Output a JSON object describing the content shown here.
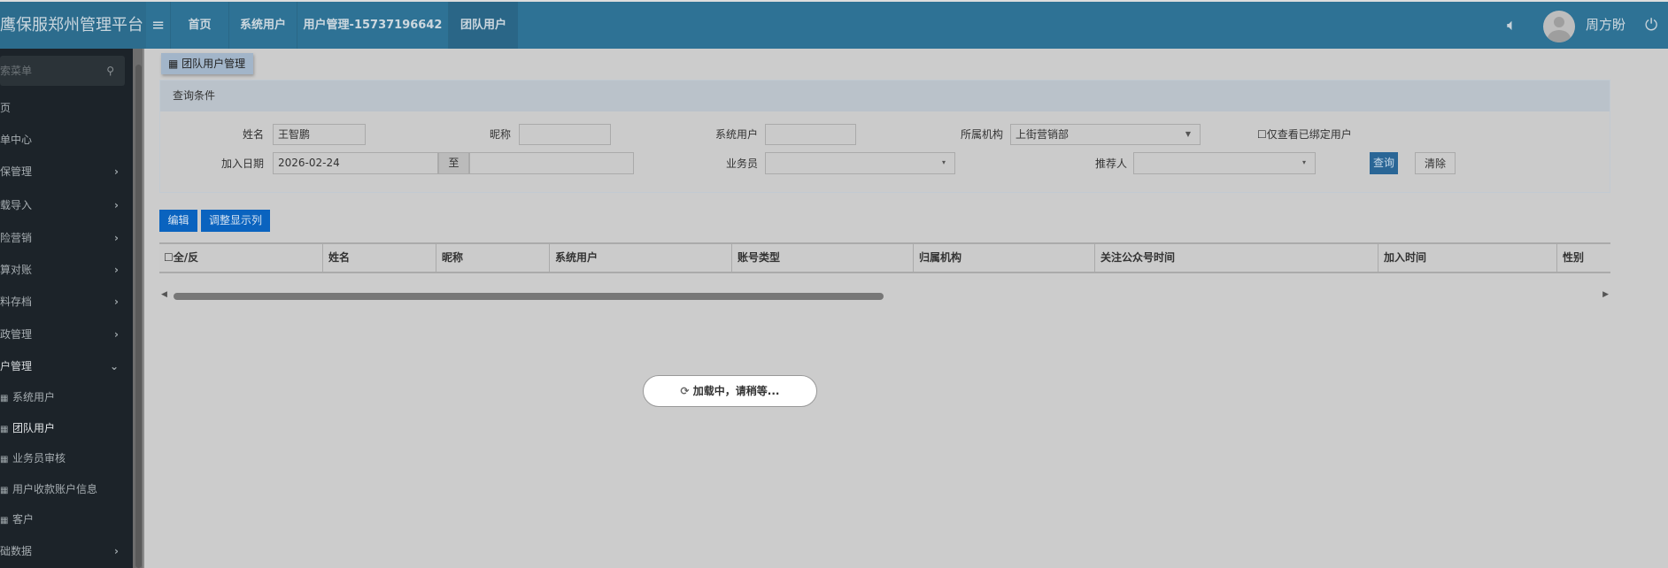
{
  "header": {
    "logo": "鹰保服郑州管理平台",
    "nav": [
      "首页",
      "系统用户",
      "用户管理-15737196642",
      "团队用户"
    ],
    "user": "周方盼"
  },
  "sidebar": {
    "search_placeholder": "搜索菜单",
    "items": [
      "首页",
      "出单中心",
      "投保管理",
      "下载导入",
      "车险营销",
      "结算对账",
      "资料存档",
      "行政管理",
      "用户管理"
    ],
    "sub_items": [
      "系统用户",
      "团队用户",
      "业务员审核",
      "用户收款账户信息",
      "客户"
    ],
    "last": "基础数据"
  },
  "tab": "团队用户管理",
  "query": {
    "title": "查询条件",
    "name_label": "姓名",
    "name_value": "王智鹏",
    "nick_label": "昵称",
    "sys_label": "系统用户",
    "org_label": "所属机构",
    "org_value": "上街营销部",
    "bound_only": "仅查看已绑定用户",
    "date_label": "加入日期",
    "date_from": "2026-02-24",
    "date_to_label": "至",
    "sales_label": "业务员",
    "ref_label": "推荐人",
    "search_btn": "查询",
    "clear_btn": "清除"
  },
  "toolbar": {
    "edit": "编辑",
    "columns": "调整显示列"
  },
  "table": {
    "columns": [
      "全/反",
      "姓名",
      "昵称",
      "系统用户",
      "账号类型",
      "归属机构",
      "关注公众号时间",
      "加入时间",
      "性别"
    ]
  },
  "loading": "加载中，请稍等..."
}
